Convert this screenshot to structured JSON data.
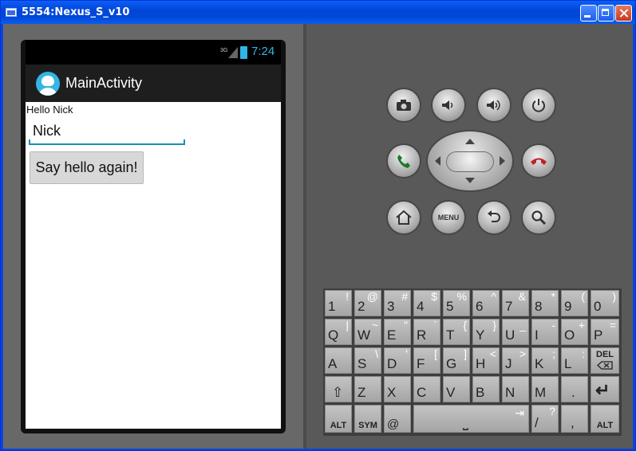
{
  "window": {
    "title": "5554:Nexus_S_v10"
  },
  "phone": {
    "status": {
      "network": "3G",
      "time": "7:24"
    },
    "action_bar": {
      "title": "MainActivity"
    },
    "content": {
      "greeting": "Hello Nick",
      "name_input_value": "Nick",
      "button_label": "Say hello again!"
    }
  },
  "controls": {
    "menu_label": "MENU"
  },
  "keyboard": {
    "row1": [
      {
        "m": "1",
        "s": "!"
      },
      {
        "m": "2",
        "s": "@"
      },
      {
        "m": "3",
        "s": "#"
      },
      {
        "m": "4",
        "s": "$"
      },
      {
        "m": "5",
        "s": "%"
      },
      {
        "m": "6",
        "s": "^"
      },
      {
        "m": "7",
        "s": "&"
      },
      {
        "m": "8",
        "s": "*"
      },
      {
        "m": "9",
        "s": "("
      },
      {
        "m": "0",
        "s": ")"
      }
    ],
    "row2": [
      {
        "m": "Q",
        "s": "|"
      },
      {
        "m": "W",
        "s": "~"
      },
      {
        "m": "E",
        "s": "\""
      },
      {
        "m": "R",
        "s": "`"
      },
      {
        "m": "T",
        "s": "{"
      },
      {
        "m": "Y",
        "s": "}"
      },
      {
        "m": "U",
        "s": "_"
      },
      {
        "m": "I",
        "s": "-"
      },
      {
        "m": "O",
        "s": "+"
      },
      {
        "m": "P",
        "s": "="
      }
    ],
    "row3": [
      {
        "m": "A",
        "s": ""
      },
      {
        "m": "S",
        "s": "\\"
      },
      {
        "m": "D",
        "s": "'"
      },
      {
        "m": "F",
        "s": "["
      },
      {
        "m": "G",
        "s": "]"
      },
      {
        "m": "H",
        "s": "<"
      },
      {
        "m": "J",
        "s": ">"
      },
      {
        "m": "K",
        "s": ";"
      },
      {
        "m": "L",
        "s": ":"
      },
      {
        "m": "",
        "s": "",
        "c": "DEL"
      }
    ],
    "row4": [
      {
        "m": "⇧",
        "s": ""
      },
      {
        "m": "Z",
        "s": ""
      },
      {
        "m": "X",
        "s": ""
      },
      {
        "m": "C",
        "s": ""
      },
      {
        "m": "V",
        "s": ""
      },
      {
        "m": "B",
        "s": ""
      },
      {
        "m": "N",
        "s": ""
      },
      {
        "m": "M",
        "s": ""
      },
      {
        "m": ".",
        "s": ""
      },
      {
        "m": "↵",
        "s": ""
      }
    ],
    "row5": {
      "alt_left": "ALT",
      "sym": "SYM",
      "at": "@",
      "space": "⎵",
      "tab": "⇥",
      "slash": "/",
      "question": "?",
      "comma": ",",
      "alt_right": "ALT"
    }
  }
}
